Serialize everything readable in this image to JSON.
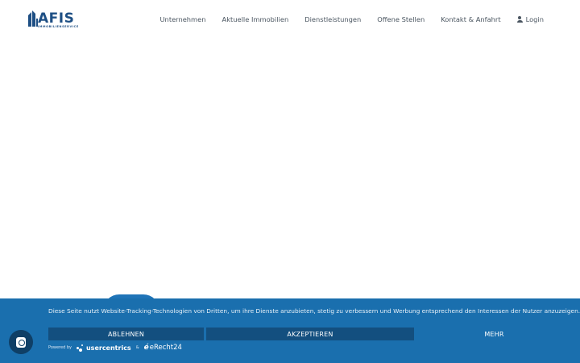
{
  "header": {
    "logo_text": "AFIS",
    "logo_subtext": "IMMOBILIENSERVICE",
    "brand_color": "#1e4f84",
    "nav": [
      {
        "label": "Unternehmen"
      },
      {
        "label": "Aktuelle Immobilien"
      },
      {
        "label": "Dienstleistungen"
      },
      {
        "label": "Offene Stellen"
      },
      {
        "label": "Kontakt & Anfahrt"
      }
    ],
    "login": {
      "label": "Login",
      "icon": "user-icon"
    }
  },
  "cookie_banner": {
    "background": "#1a6fae",
    "message": "Diese Seite nutzt Website-Tracking-Technologien von Dritten, um ihre Dienste anzubieten, stetig zu verbessern und Werbung entsprechend den Interessen der Nutzer anzuzeigen.",
    "buttons": {
      "deny": "ABLEHNEN",
      "accept": "AKZEPTIEREN",
      "more": "MEHR"
    },
    "powered_by": "Powered by",
    "provider_one": "usercentrics",
    "ampersand": "&",
    "provider_two": "eRecht24",
    "provider_two_mark": "é"
  },
  "privacy_button": {
    "icon": "fingerprint-icon"
  }
}
